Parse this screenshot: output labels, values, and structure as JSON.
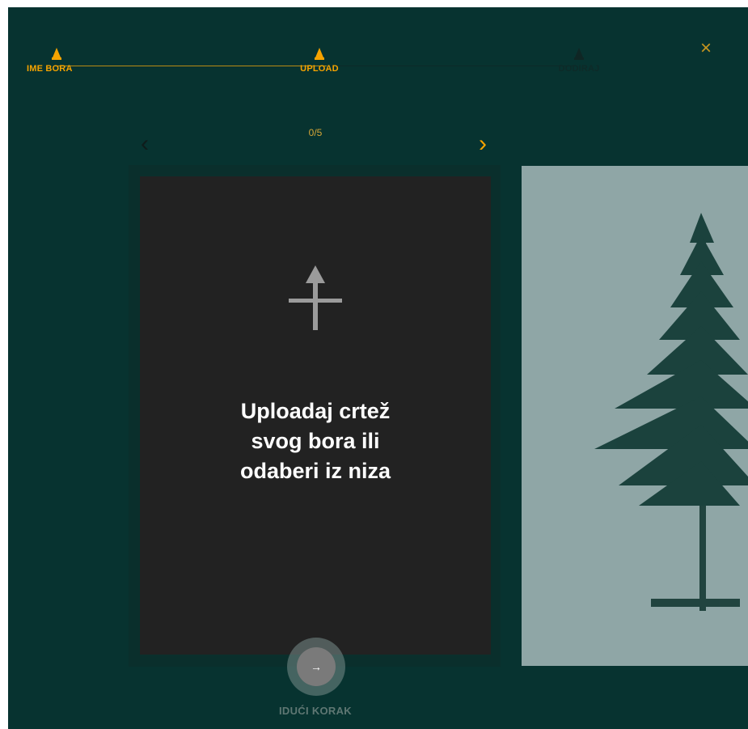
{
  "stepper": {
    "steps": [
      {
        "label": "IME BORA",
        "state": "done"
      },
      {
        "label": "UPLOAD",
        "state": "active"
      },
      {
        "label": "DODIRAJ",
        "state": "inactive"
      }
    ]
  },
  "close_icon": "close-icon",
  "carousel": {
    "counter": "0/5",
    "prev_icon": "chevron-left-icon",
    "next_icon": "chevron-right-icon"
  },
  "upload_card": {
    "icon": "upload-arrow-icon",
    "lines": [
      "Uploadaj crtež",
      "svog bora ili",
      "odaberi iz niza"
    ]
  },
  "next_step": {
    "label": "IDUĆI KORAK",
    "icon": "arrow-right-icon"
  },
  "colors": {
    "background": "#073330",
    "accent": "#f5a300",
    "card": "#222222",
    "tree_card": "#8fa6a6"
  }
}
